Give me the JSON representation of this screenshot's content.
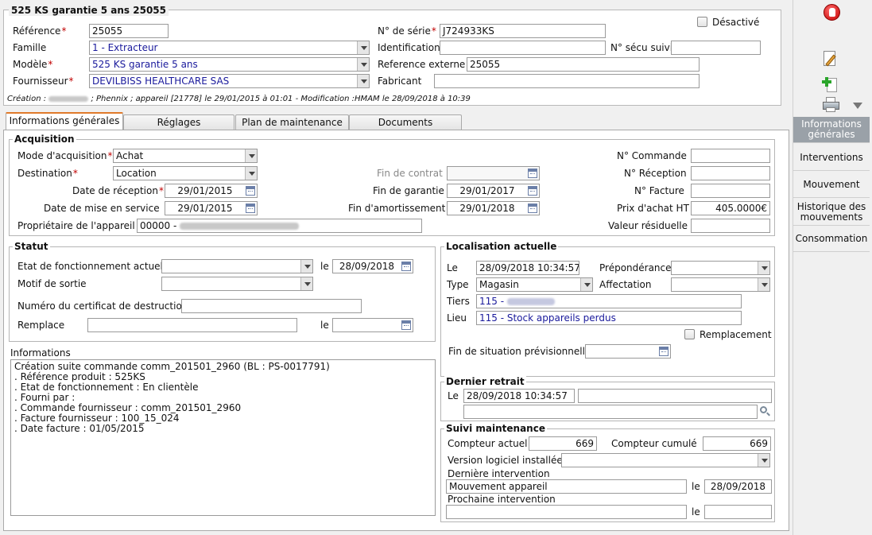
{
  "header": {
    "title": "525 KS garantie 5 ans 25055",
    "desactive_label": "Désactivé",
    "fields": {
      "reference": {
        "label": "Référence",
        "value": "25055"
      },
      "famille": {
        "label": "Famille",
        "value": "1 - Extracteur"
      },
      "modele": {
        "label": "Modèle",
        "value": "525 KS garantie 5 ans"
      },
      "fournisseur": {
        "label": "Fournisseur",
        "value": "DEVILBISS HEALTHCARE SAS"
      },
      "serie": {
        "label": "N° de série",
        "value": "J724933KS"
      },
      "identification": {
        "label": "Identification",
        "value": ""
      },
      "secu": {
        "label": "N° sécu suivi",
        "value": ""
      },
      "ref_externe": {
        "label": "Reference externe",
        "value": "25055"
      },
      "fabricant": {
        "label": "Fabricant",
        "value": ""
      }
    },
    "creation_prefix": "Création :",
    "creation_suffix": "; Phennix ; appareil [21778] le 29/01/2015 à 01:01 - Modification :HMAM le 28/09/2018 à 10:39"
  },
  "tabs": [
    "Informations générales",
    "Réglages",
    "Plan de maintenance",
    "Documents"
  ],
  "acquisition": {
    "title": "Acquisition",
    "mode": {
      "label": "Mode d'acquisition",
      "value": "Achat"
    },
    "destination": {
      "label": "Destination",
      "value": "Location"
    },
    "date_reception": {
      "label": "Date de réception",
      "value": "29/01/2015"
    },
    "date_service": {
      "label": "Date de mise en service",
      "value": "29/01/2015"
    },
    "proprietaire": {
      "label": "Propriétaire de l'appareil",
      "value": "00000 -"
    },
    "fin_contrat": {
      "label": "Fin de contrat",
      "value": ""
    },
    "fin_garantie": {
      "label": "Fin de garantie",
      "value": "29/01/2017"
    },
    "fin_amort": {
      "label": "Fin d'amortissement",
      "value": "29/01/2018"
    },
    "commande": {
      "label": "N° Commande",
      "value": ""
    },
    "reception": {
      "label": "N° Réception",
      "value": ""
    },
    "facture": {
      "label": "N° Facture",
      "value": ""
    },
    "prix": {
      "label": "Prix d'achat HT",
      "value": "405.0000€"
    },
    "residuelle": {
      "label": "Valeur résiduelle",
      "value": ""
    }
  },
  "statut": {
    "title": "Statut",
    "etat": {
      "label": "Etat de fonctionnement actuel",
      "value": ""
    },
    "le_label": "le",
    "etat_date": "28/09/2018",
    "motif": {
      "label": "Motif de sortie",
      "value": ""
    },
    "certificat": {
      "label": "Numéro du certificat de destruction",
      "value": ""
    },
    "remplace": {
      "label": "Remplace",
      "value": ""
    },
    "remplace_date": ""
  },
  "informations": {
    "title": "Informations",
    "text": "Création suite commande comm_201501_2960 (BL : PS-0017791)\n. Référence produit : 525KS\n. Etat de fonctionnement : En clientèle\n. Fourni par :\n. Commande fournisseur : comm_201501_2960\n. Facture fournisseur : 100_15_024\n. Date facture : 01/05/2015"
  },
  "localisation": {
    "title": "Localisation actuelle",
    "le": {
      "label": "Le",
      "value": "28/09/2018 10:34:57"
    },
    "preponderance": {
      "label": "Prépondérance",
      "value": ""
    },
    "type": {
      "label": "Type",
      "value": "Magasin"
    },
    "affectation": {
      "label": "Affectation",
      "value": ""
    },
    "tiers": {
      "label": "Tiers",
      "value": "115 -"
    },
    "lieu": {
      "label": "Lieu",
      "value": "115 - Stock appareils perdus"
    },
    "remplacement_label": "Remplacement",
    "fin_situation": {
      "label": "Fin de situation prévisionnelle",
      "value": ""
    }
  },
  "dernier_retrait": {
    "title": "Dernier retrait",
    "le": {
      "label": "Le",
      "value": "28/09/2018 10:34:57"
    },
    "detail": "",
    "detail2": ""
  },
  "suivi": {
    "title": "Suivi maintenance",
    "compteur_actuel": {
      "label": "Compteur actuel",
      "value": "669"
    },
    "compteur_cumule": {
      "label": "Compteur cumulé",
      "value": "669"
    },
    "version": {
      "label": "Version logiciel installée",
      "value": ""
    },
    "derniere_label": "Dernière intervention",
    "derniere_value": "Mouvement appareil",
    "derniere_date": "28/09/2018",
    "prochaine_label": "Prochaine intervention",
    "prochaine_value": "",
    "prochaine_date": "",
    "le_label": "le"
  },
  "sidebar": {
    "items": [
      "Informations générales",
      "Interventions",
      "Mouvement",
      "Historique des mouvements",
      "Consommation"
    ]
  },
  "colors": {
    "accent_tab": "#e07a2a",
    "required": "#c00000",
    "sidebar_active": "#9aa1a8"
  }
}
